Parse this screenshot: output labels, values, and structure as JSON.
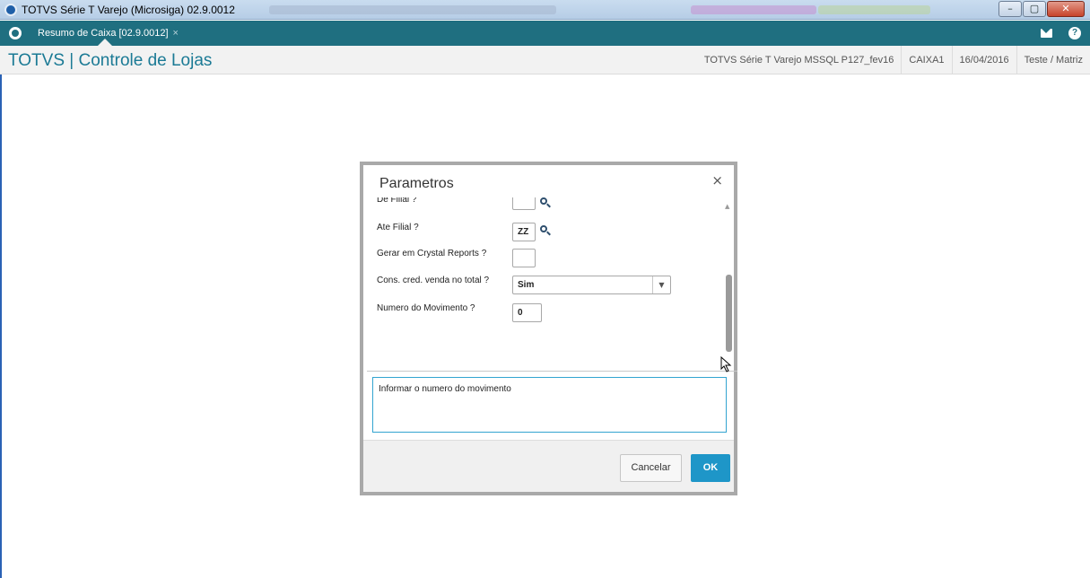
{
  "window": {
    "title": "TOTVS Série T Varejo (Microsiga) 02.9.0012",
    "minimize_glyph": "–",
    "maximize_glyph": "▢",
    "close_glyph": "✕"
  },
  "tabs": [
    {
      "label": "Resumo de Caixa [02.9.0012]",
      "close": "×"
    }
  ],
  "header": {
    "app_title": "TOTVS | Controle de Lojas",
    "environment": "TOTVS Série T Varejo MSSQL P127_fev16",
    "station": "CAIXA1",
    "date": "16/04/2016",
    "company": "Teste / Matriz"
  },
  "icons": {
    "home": "totvs-home-icon",
    "mail": "mail-icon",
    "help": "help-icon",
    "help_glyph": "?"
  },
  "dialog": {
    "title": "Parametros",
    "close": "×",
    "params": [
      {
        "label": "De Filial ?",
        "value": ""
      },
      {
        "label": "Ate Filial ?",
        "value": "ZZ"
      },
      {
        "label": "Gerar em Crystal Reports ?",
        "value": ""
      },
      {
        "label": "Cons. cred. venda no total ?",
        "value": "Sim"
      },
      {
        "label": "Numero do Movimento ?",
        "value": "0"
      }
    ],
    "select_arrow": "▼",
    "scroll_up": "▲",
    "help_text": "Informar o numero do movimento",
    "cancel_label": "Cancelar",
    "ok_label": "OK"
  },
  "colors": {
    "tabbar": "#1f6f80",
    "brand": "#1b7a95",
    "primary_button": "#1e96c8",
    "help_border": "#33a4d0"
  }
}
